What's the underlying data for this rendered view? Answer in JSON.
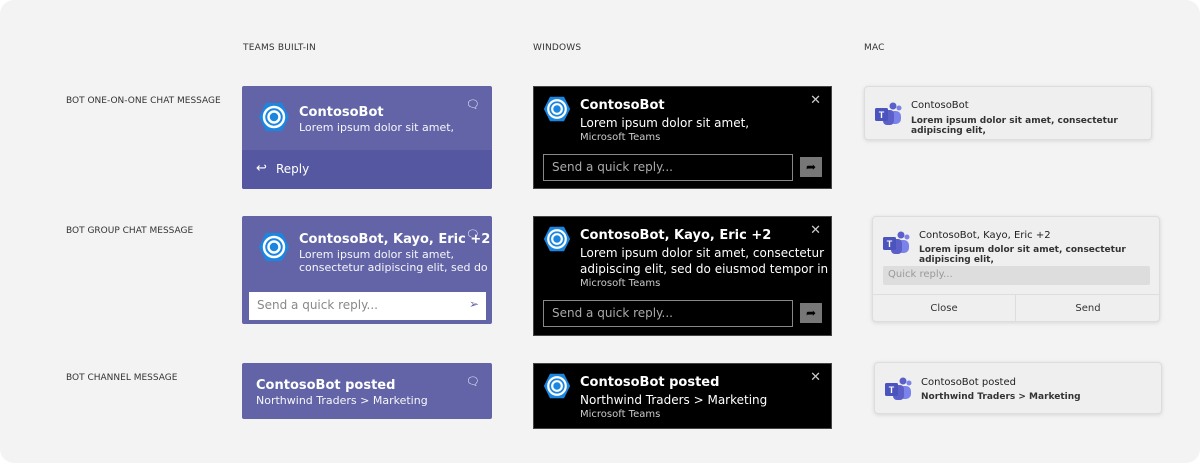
{
  "columns": [
    "TEAMS BUILT-IN",
    "WINDOWS",
    "MAC"
  ],
  "rows": [
    "BOT ONE-ON-ONE CHAT MESSAGE",
    "BOT GROUP CHAT MESSAGE",
    "BOT CHANNEL MESSAGE"
  ],
  "teams": {
    "one": {
      "title": "ContosoBot",
      "body": "Lorem ipsum dolor sit amet,",
      "reply": "Reply"
    },
    "group": {
      "title": "ContosoBot, Kayo, Eric +2",
      "body1": "Lorem ipsum dolor sit amet,",
      "body2": "consectetur adipiscing elit, sed do",
      "placeholder": "Send a quick reply..."
    },
    "channel": {
      "title": "ContosoBot posted",
      "body": "Northwind Traders > Marketing"
    }
  },
  "windows": {
    "one": {
      "title": "ContosoBot",
      "body": "Lorem ipsum dolor sit amet,",
      "app": "Microsoft Teams",
      "placeholder": "Send a quick reply..."
    },
    "group": {
      "title": "ContosoBot, Kayo, Eric +2",
      "body1": "Lorem ipsum dolor sit amet, consectetur",
      "body2": "adipiscing elit, sed do eiusmod tempor in",
      "app": "Microsoft Teams",
      "placeholder": "Send a quick reply..."
    },
    "channel": {
      "title": "ContosoBot posted",
      "body": "Northwind Traders > Marketing",
      "app": "Microsoft Teams"
    }
  },
  "mac": {
    "one": {
      "title": "ContosoBot",
      "body": "Lorem ipsum dolor sit amet, consectetur adipiscing elit,"
    },
    "group": {
      "title": "ContosoBot, Kayo, Eric +2",
      "body": "Lorem ipsum dolor sit amet, consectetur adipiscing elit,",
      "placeholder": "Quick reply...",
      "close": "Close",
      "send": "Send"
    },
    "channel": {
      "title": "ContosoBot posted",
      "body": "Northwind Traders > Marketing"
    }
  },
  "colors": {
    "teams_purple": "#6264a7",
    "teams_reply": "#5558a0",
    "windows_bg": "#000000",
    "bot_blue": "#0f78d4"
  }
}
